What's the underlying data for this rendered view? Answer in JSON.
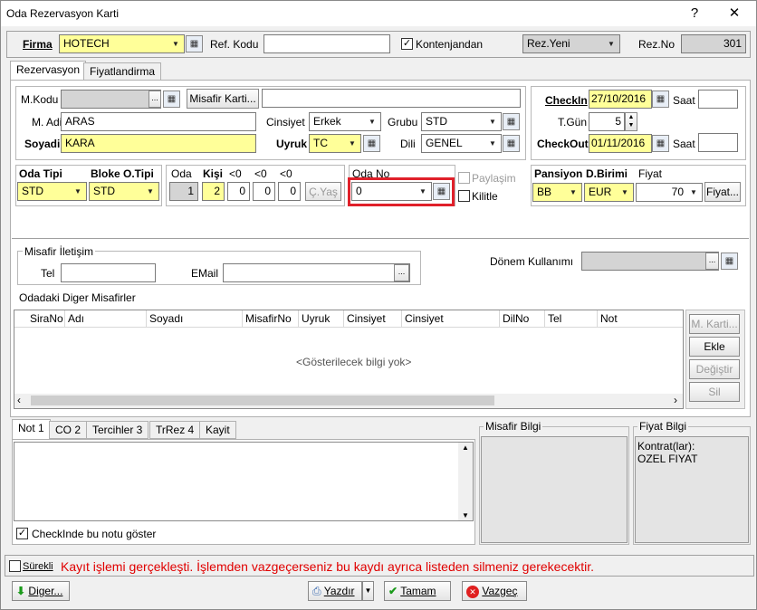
{
  "window": {
    "title": "Oda Rezervasyon Karti",
    "help_label": "?",
    "close_label": "✕"
  },
  "top": {
    "firma_label": "Firma",
    "firma_value": "HOTECH",
    "ref_kodu_label": "Ref. Kodu",
    "ref_kodu_value": "",
    "kontenjan_label": "Kontenjandan",
    "rez_state": "Rez.Yeni",
    "rez_no_label": "Rez.No",
    "rez_no_value": "301"
  },
  "tabs": [
    "Rezervasyon",
    "Fiyatlandirma"
  ],
  "guest": {
    "mkodu_label": "M.Kodu",
    "mkodu_value": "",
    "misafir_karti_label": "Misafir Karti...",
    "madi_label": "M. Adi",
    "madi_value": "ARAS",
    "soyadi_label": "Soyadi",
    "soyadi_value": "KARA",
    "cinsiyet_label": "Cinsiyet",
    "cinsiyet_value": "Erkek",
    "grubu_label": "Grubu",
    "grubu_value": "STD",
    "uyruk_label": "Uyruk",
    "uyruk_value": "TC",
    "dili_label": "Dili",
    "dili_value": "GENEL"
  },
  "dates": {
    "checkin_label": "CheckIn",
    "checkin_value": "27/10/2016",
    "saat_label": "Saat",
    "saat_in_value": "",
    "saat_out_value": "",
    "tgun_label": "T.Gün",
    "tgun_value": "5",
    "checkout_label": "CheckOut",
    "checkout_value": "01/11/2016"
  },
  "room": {
    "oda_tipi_label": "Oda Tipi",
    "oda_tipi_value": "STD",
    "bloke_label": "Bloke O.Tipi",
    "bloke_value": "STD",
    "oda_label": "Oda",
    "kisi_label": "Kişi",
    "c1_label": "<0",
    "c2_label": "<0",
    "c3_label": "<0",
    "oda_value": "1",
    "kisi_value": "2",
    "c1_value": "0",
    "c2_value": "0",
    "c3_value": "0",
    "cyas_label": "Ç.Yaş",
    "oda_no_label": "Oda No",
    "oda_no_value": "0",
    "paylasim_label": "Paylaşim",
    "kilitle_label": "Kilitle"
  },
  "pricing": {
    "pansiyon_label": "Pansiyon",
    "pansiyon_value": "BB",
    "dbirimi_label": "D.Birimi",
    "dbirimi_value": "EUR",
    "fiyat_label": "Fiyat",
    "fiyat_value": "70",
    "fiyat_btn_label": "Fiyat..."
  },
  "contact": {
    "group_label": "Misafir İletişim",
    "tel_label": "Tel",
    "tel_value": "",
    "email_label": "EMail",
    "email_value": "",
    "donem_label": "Dönem Kullanımı",
    "donem_value": ""
  },
  "others": {
    "group_label": "Odadaki Diger Misafirler",
    "columns": [
      "SiraNo",
      "Adı",
      "Soyadı",
      "MisafirNo",
      "Uyruk",
      "Cinsiyet",
      "Cinsiyet",
      "DilNo",
      "Tel",
      "Not"
    ],
    "empty_text": "<Gösterilecek bilgi yok>",
    "btn_mkarti": "M. Karti...",
    "btn_ekle": "Ekle",
    "btn_degistir": "Değiştir",
    "btn_sil": "Sil"
  },
  "notes": {
    "tabs": [
      "Not 1",
      "CO 2",
      "Tercihler 3",
      "TrRez 4",
      "Kayit"
    ],
    "checkin_note_label": "CheckInde bu notu göster",
    "misafir_bilgi_label": "Misafir Bilgi",
    "fiyat_bilgi_label": "Fiyat Bilgi",
    "fiyat_bilgi_lines": [
      "Kontrat(lar):",
      "OZEL FIYAT"
    ]
  },
  "status": {
    "surekli_label": "Sürekli",
    "message": "Kayıt işlemi gerçekleşti. İşlemden vazgeçerseniz bu kaydı ayrıca listeden silmeniz gerekecektir.",
    "message_color": "#e00000"
  },
  "footer": {
    "diger_label": "Diger...",
    "yazdir_label": "Yazdır",
    "tamam_label": "Tamam",
    "vazgec_label": "Vazgeç"
  }
}
